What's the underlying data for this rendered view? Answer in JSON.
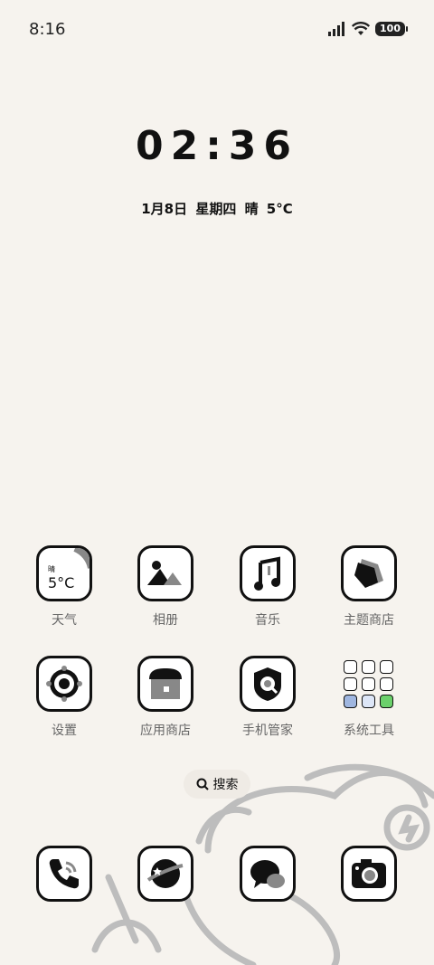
{
  "status": {
    "time": "8:16",
    "battery": "100",
    "signal_icon": "signal-icon",
    "wifi_icon": "wifi-icon"
  },
  "clock": {
    "time": "02:36"
  },
  "date": {
    "text": "1月8日  星期四  晴  5°C"
  },
  "weather_widget": {
    "condition": "晴",
    "temp": "5°C"
  },
  "apps": [
    {
      "label": "天气",
      "icon": "weather-icon"
    },
    {
      "label": "相册",
      "icon": "gallery-icon"
    },
    {
      "label": "音乐",
      "icon": "music-icon"
    },
    {
      "label": "主题商店",
      "icon": "theme-store-icon"
    },
    {
      "label": "设置",
      "icon": "settings-icon"
    },
    {
      "label": "应用商店",
      "icon": "app-store-icon"
    },
    {
      "label": "手机管家",
      "icon": "phone-manager-icon"
    },
    {
      "label": "系统工具",
      "icon": "folder-icon"
    }
  ],
  "search": {
    "label": "搜索",
    "icon": "search-icon"
  },
  "dock": [
    {
      "icon": "phone-icon"
    },
    {
      "icon": "browser-icon"
    },
    {
      "icon": "messages-icon"
    },
    {
      "icon": "camera-icon"
    }
  ]
}
